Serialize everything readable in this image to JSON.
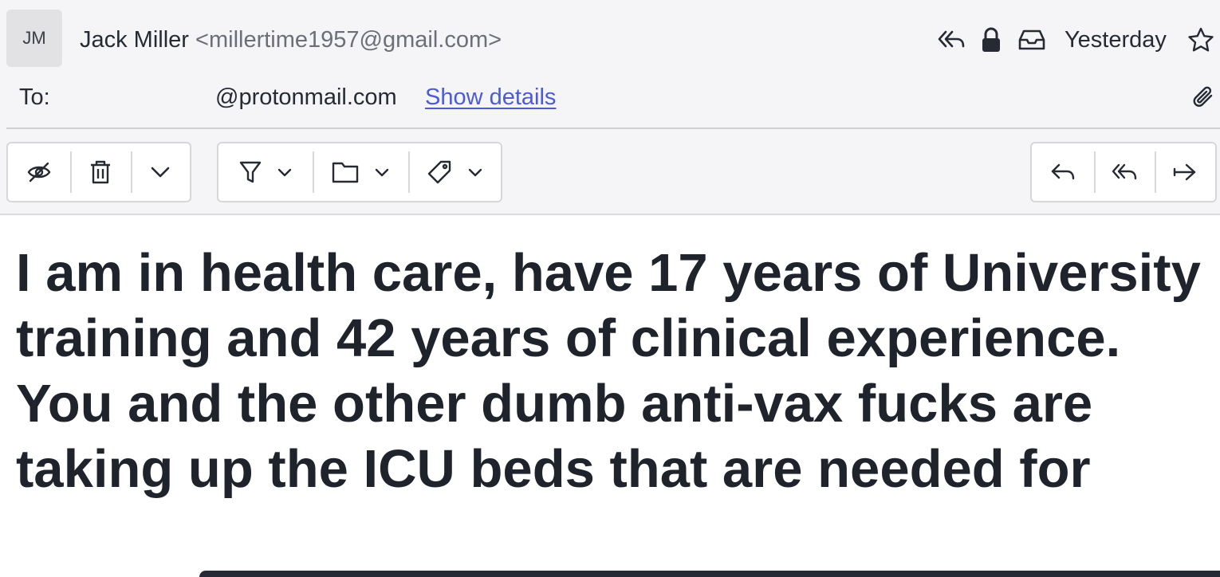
{
  "sender": {
    "initials": "JM",
    "name": "Jack Miller",
    "email": "<millertime1957@gmail.com>"
  },
  "header": {
    "date": "Yesterday",
    "icons": [
      "reply-all-icon",
      "lock-icon",
      "inbox-icon",
      "star-icon",
      "paperclip-icon"
    ]
  },
  "recipients": {
    "label": "To:",
    "address": "@protonmail.com",
    "details_link": "Show details"
  },
  "toolbar": {
    "group1": [
      "mark-unread-eye-slash-icon",
      "trash-icon",
      "chevron-down-icon"
    ],
    "group2": [
      "filter-icon",
      "folder-icon",
      "tag-icon"
    ],
    "group3": [
      "reply-icon",
      "reply-all-icon",
      "forward-icon"
    ]
  },
  "message": {
    "line1": "I am in health care, have 17 years of University training and 42 years of clinical experience.",
    "line2": "You and the other dumb anti-vax fucks are taking up the ICU beds that are needed for"
  },
  "colors": {
    "link": "#4c5bd4",
    "header_bg": "#f5f5f7",
    "text": "#262a33"
  }
}
